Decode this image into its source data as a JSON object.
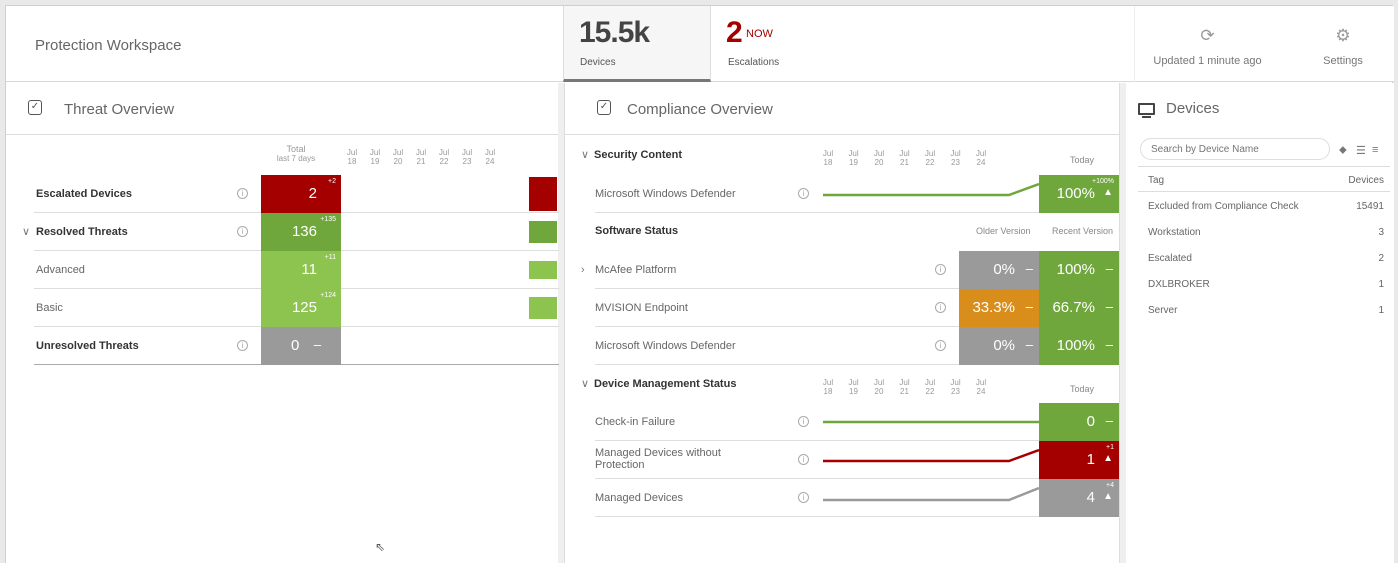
{
  "header": {
    "workspace_title": "Protection Workspace",
    "devices_value": "15.5k",
    "devices_label": "Devices",
    "escalations_value": "2",
    "escalations_now": "NOW",
    "escalations_label": "Escalations",
    "updated_label": "Updated 1 minute ago",
    "settings_label": "Settings"
  },
  "threat": {
    "title": "Threat Overview",
    "total_label": "Total",
    "total_sub": "last 7 days",
    "days": [
      {
        "m": "Jul",
        "d": "18"
      },
      {
        "m": "Jul",
        "d": "19"
      },
      {
        "m": "Jul",
        "d": "20"
      },
      {
        "m": "Jul",
        "d": "21"
      },
      {
        "m": "Jul",
        "d": "22"
      },
      {
        "m": "Jul",
        "d": "23"
      },
      {
        "m": "Jul",
        "d": "24"
      }
    ],
    "rows": [
      {
        "label": "Escalated Devices",
        "value": "2",
        "delta": "+2"
      },
      {
        "label": "Resolved Threats",
        "value": "136",
        "delta": "+135"
      },
      {
        "label": "Advanced",
        "value": "11",
        "delta": "+11"
      },
      {
        "label": "Basic",
        "value": "125",
        "delta": "+124"
      },
      {
        "label": "Unresolved Threats",
        "value": "0",
        "delta": "–"
      }
    ]
  },
  "compliance": {
    "title": "Compliance Overview",
    "security_content": "Security Content",
    "today": "Today",
    "days": [
      {
        "m": "Jul",
        "d": "18"
      },
      {
        "m": "Jul",
        "d": "19"
      },
      {
        "m": "Jul",
        "d": "20"
      },
      {
        "m": "Jul",
        "d": "21"
      },
      {
        "m": "Jul",
        "d": "22"
      },
      {
        "m": "Jul",
        "d": "23"
      },
      {
        "m": "Jul",
        "d": "24"
      }
    ],
    "defender_label": "Microsoft Windows Defender",
    "defender_value": "100%",
    "defender_delta": "+100%",
    "software_status": "Software Status",
    "older_version": "Older Version",
    "recent_version": "Recent Version",
    "software": [
      {
        "label": "McAfee Platform",
        "older": "0%",
        "recent": "100%"
      },
      {
        "label": "MVISION Endpoint",
        "older": "33.3%",
        "recent": "66.7%"
      },
      {
        "label": "Microsoft Windows Defender",
        "older": "0%",
        "recent": "100%"
      }
    ],
    "dm_status": "Device Management Status",
    "dm": [
      {
        "label": "Check-in Failure",
        "value": "0",
        "delta": ""
      },
      {
        "label": "Managed Devices without Protection",
        "value": "1",
        "delta": "+1"
      },
      {
        "label": "Managed Devices",
        "value": "4",
        "delta": "+4"
      }
    ],
    "dash": "–",
    "up": "▲"
  },
  "devices": {
    "title": "Devices",
    "search_placeholder": "Search by Device Name",
    "tag_header": "Tag",
    "devices_header": "Devices",
    "tags": [
      {
        "name": "Excluded from Compliance Check",
        "count": "15491"
      },
      {
        "name": "Workstation",
        "count": "3"
      },
      {
        "name": "Escalated",
        "count": "2"
      },
      {
        "name": "DXLBROKER",
        "count": "1"
      },
      {
        "name": "Server",
        "count": "1"
      }
    ]
  },
  "colors": {
    "red": "#a40000",
    "green": "#6fa73d",
    "light_green": "#8dc34f",
    "grey": "#9a9a9a",
    "orange": "#d98e1b"
  }
}
